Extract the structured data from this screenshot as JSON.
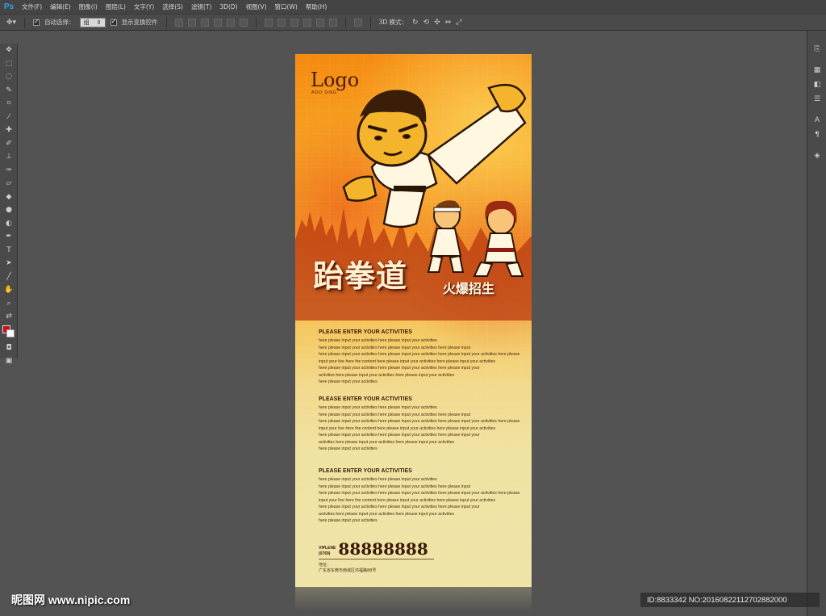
{
  "app": {
    "logo": "Ps"
  },
  "menu": [
    "文件(F)",
    "编辑(E)",
    "图像(I)",
    "图层(L)",
    "文字(Y)",
    "选择(S)",
    "滤镜(T)",
    "3D(D)",
    "视图(V)",
    "窗口(W)",
    "帮助(H)"
  ],
  "options": {
    "auto_select_label": "自动选择：",
    "auto_select_value": "组",
    "show_transform_label": "显示变换控件",
    "mode_3d_label": "3D 模式："
  },
  "poster": {
    "logo": "Logo",
    "logo_sub": "ADD SING",
    "title_main": "跆拳道",
    "title_sub": "火爆招生",
    "sections": [
      {
        "title": "PLEASE ENTER YOUR ACTIVITIES",
        "lines": [
          "here please input your activities here please input your activities",
          "here please input your activities here please input your activities here please input",
          "here please input your activities here please input your activities here please input your activities here please",
          "input your live here the content here please input your activities here please input your activities",
          "here please input your activities here please input your activities here please input your",
          " activities here please input your activities here please input your activities",
          "here please input your activities"
        ]
      },
      {
        "title": "PLEASE ENTER YOUR ACTIVITIES",
        "lines": [
          "here please input your activities here please input your activities",
          "here please input your activities here please input your activities here please input",
          "here please input your activities here please input your activities here please input your activities here please",
          "input your live here the content here please input your activities here please input your activities",
          "here please input your activities here please input your activities here please input your",
          " activities here please input your activities here please input your activities",
          "here please input your activities"
        ]
      },
      {
        "title": "PLEASE ENTER YOUR ACTIVITIES",
        "lines": [
          "here please input your activities here please input your activities",
          "here please input your activities here please input your activities here please input",
          "here please input your activities here please input your activities here please input your activities here please",
          "input your live here the content here please input your activities here please input your activities",
          "here please input your activities here please input your activities here please input your",
          " activities here please input your activities here please input your activities",
          "here please input your activities"
        ]
      }
    ],
    "contact": {
      "label_1": "VIPLENE",
      "label_2": "(0769)",
      "phone": "88888888",
      "address_label": "地址：",
      "address": "广东省东莞市南城区鸿福路88号"
    }
  },
  "watermarks": {
    "left": "昵图网 www.nipic.com",
    "right": "ID:8833342 NO:20160822112702882000"
  },
  "colors": {
    "foreground": "#c8101a",
    "background": "#ffffff",
    "workspace": "#535353"
  }
}
